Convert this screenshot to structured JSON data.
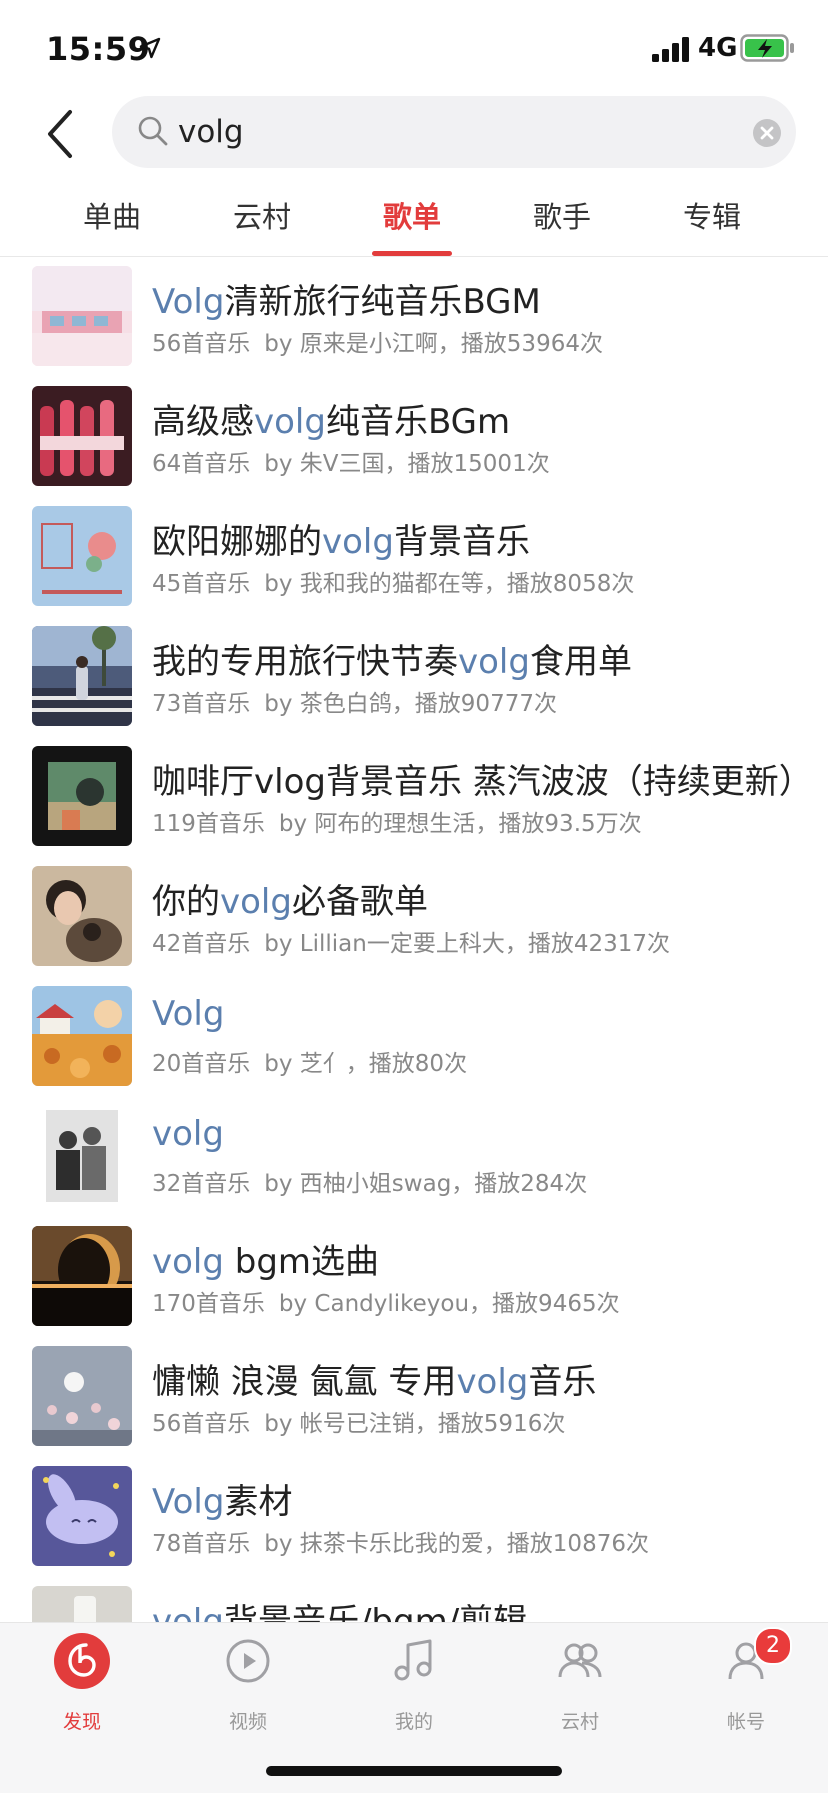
{
  "status_bar": {
    "time": "15:59",
    "network": "4G"
  },
  "search": {
    "value": "volg"
  },
  "tabs": [
    {
      "label": "单曲",
      "active": false
    },
    {
      "label": "云村",
      "active": false
    },
    {
      "label": "歌单",
      "active": true
    },
    {
      "label": "歌手",
      "active": false
    },
    {
      "label": "专辑",
      "active": false
    }
  ],
  "playlists": [
    {
      "title_pre": "",
      "title_hl": "Volg",
      "title_post": "清新旅行纯音乐BGM",
      "count": "56首音乐",
      "by": "by 原来是小江啊，播放53964次"
    },
    {
      "title_pre": "高级感",
      "title_hl": "volg",
      "title_post": "纯音乐BGm",
      "count": "64首音乐",
      "by": "by 朱Ⅴ三国，播放15001次"
    },
    {
      "title_pre": "欧阳娜娜的",
      "title_hl": "volg",
      "title_post": "背景音乐",
      "count": "45首音乐",
      "by": "by 我和我的猫都在等，播放8058次"
    },
    {
      "title_pre": "我的专用旅行快节奏",
      "title_hl": "volg",
      "title_post": "食用单",
      "count": "73首音乐",
      "by": "by 茶色白鸽，播放90777次"
    },
    {
      "title_pre": "咖啡厅vlog背景音乐 蒸汽波波（持续更新）",
      "title_hl": "",
      "title_post": "",
      "count": "119首音乐",
      "by": "by 阿布的理想生活，播放93.5万次"
    },
    {
      "title_pre": "你的",
      "title_hl": "volg",
      "title_post": "必备歌单",
      "count": "42首音乐",
      "by": "by Lillian一定要上科大，播放42317次"
    },
    {
      "title_pre": "",
      "title_hl": "Volg",
      "title_post": "",
      "count": "20首音乐",
      "by": "by 芝亻，播放80次"
    },
    {
      "title_pre": "",
      "title_hl": "volg",
      "title_post": "",
      "count": "32首音乐",
      "by": "by 西柚小姐swag，播放284次"
    },
    {
      "title_pre": "",
      "title_hl": "volg",
      "title_post": " bgm选曲",
      "count": "170首音乐",
      "by": "by Candylikeyou，播放9465次"
    },
    {
      "title_pre": "慵懒 浪漫 氤氲 专用",
      "title_hl": "volg",
      "title_post": "音乐",
      "count": "56首音乐",
      "by": "by 帐号已注销，播放5916次"
    },
    {
      "title_pre": "",
      "title_hl": "Volg",
      "title_post": "素材",
      "count": "78首音乐",
      "by": "by 抹茶卡乐比我的爱，播放10876次"
    },
    {
      "title_pre": "",
      "title_hl": "volg",
      "title_post": "背景音乐/bgm/剪辑",
      "count": "",
      "by": ""
    }
  ],
  "tabbar": [
    {
      "label": "发现",
      "icon": "discover-icon",
      "active": true
    },
    {
      "label": "视频",
      "icon": "video-icon",
      "active": false
    },
    {
      "label": "我的",
      "icon": "music-note-icon",
      "active": false
    },
    {
      "label": "云村",
      "icon": "community-icon",
      "active": false
    },
    {
      "label": "帐号",
      "icon": "account-icon",
      "active": false,
      "badge": "2"
    }
  ],
  "colors": {
    "accent": "#e23c3c",
    "highlight": "#5b7fae",
    "meta": "#888888"
  }
}
